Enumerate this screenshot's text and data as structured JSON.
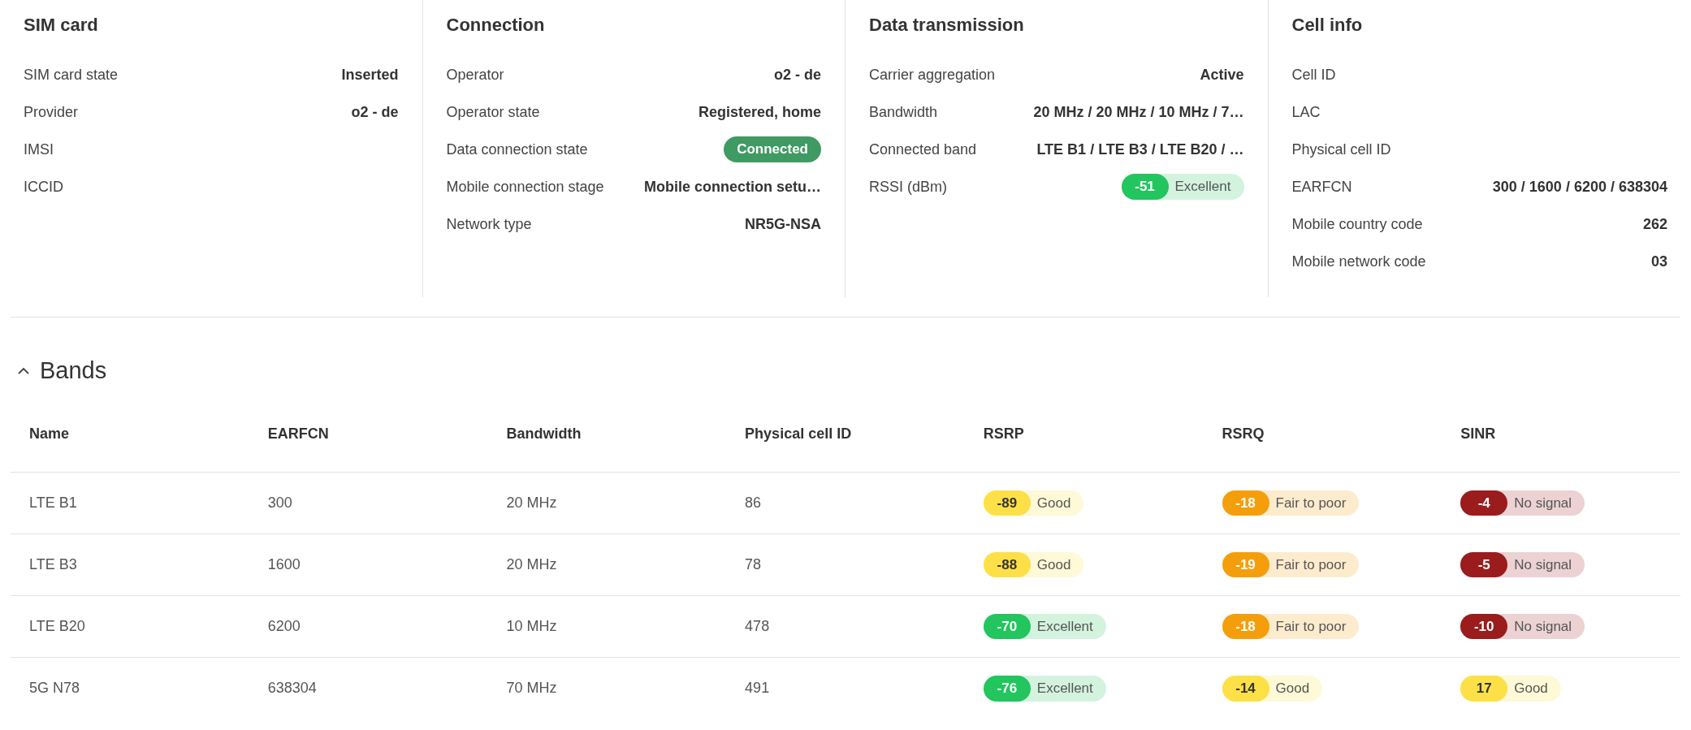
{
  "panels": [
    {
      "title": "SIM card",
      "rows": [
        {
          "kind": "text",
          "label": "SIM card state",
          "value": "Inserted"
        },
        {
          "kind": "text",
          "label": "Provider",
          "value": "o2 - de"
        },
        {
          "kind": "text",
          "label": "IMSI"
        },
        {
          "kind": "text",
          "label": "ICCID"
        }
      ]
    },
    {
      "title": "Connection",
      "rows": [
        {
          "kind": "text",
          "label": "Operator",
          "value": "o2 - de"
        },
        {
          "kind": "text",
          "label": "Operator state",
          "value": "Registered, home"
        },
        {
          "kind": "status",
          "label": "Data connection state",
          "value": "Connected"
        },
        {
          "kind": "text",
          "label": "Mobile connection stage",
          "value": "Mobile connection setu…"
        },
        {
          "kind": "text",
          "label": "Network type",
          "value": "NR5G-NSA"
        }
      ]
    },
    {
      "title": "Data transmission",
      "rows": [
        {
          "kind": "text",
          "label": "Carrier aggregation",
          "value": "Active"
        },
        {
          "kind": "text",
          "label": "Bandwidth",
          "value": "20 MHz / 20 MHz / 10 MHz / 7…"
        },
        {
          "kind": "text",
          "label": "Connected band",
          "value": "LTE B1 / LTE B3 / LTE B20 / …"
        },
        {
          "kind": "signal",
          "label": "RSSI (dBm)",
          "signal": {
            "value": "-51",
            "kind": "excellent",
            "rating": "Excellent"
          }
        }
      ]
    },
    {
      "title": "Cell info",
      "rows": [
        {
          "kind": "text",
          "label": "Cell ID"
        },
        {
          "kind": "text",
          "label": "LAC"
        },
        {
          "kind": "text",
          "label": "Physical cell ID"
        },
        {
          "kind": "text",
          "label": "EARFCN",
          "value": "300 / 1600 / 6200 / 638304"
        },
        {
          "kind": "text",
          "label": "Mobile country code",
          "value": "262"
        },
        {
          "kind": "text",
          "label": "Mobile network code",
          "value": "03"
        }
      ]
    }
  ],
  "bands": {
    "title": "Bands",
    "expanded": true,
    "columns": [
      "Name",
      "EARFCN",
      "Bandwidth",
      "Physical cell ID",
      "RSRP",
      "RSRQ",
      "SINR"
    ],
    "rows": [
      {
        "cells": [
          "LTE B1",
          "300",
          "20 MHz",
          "86"
        ],
        "signals": [
          {
            "value": "-89",
            "kind": "good",
            "rating": "Good"
          },
          {
            "value": "-18",
            "kind": "fair",
            "rating": "Fair to poor"
          },
          {
            "value": "-4",
            "kind": "none",
            "rating": "No signal"
          }
        ]
      },
      {
        "cells": [
          "LTE B3",
          "1600",
          "20 MHz",
          "78"
        ],
        "signals": [
          {
            "value": "-88",
            "kind": "good",
            "rating": "Good"
          },
          {
            "value": "-19",
            "kind": "fair",
            "rating": "Fair to poor"
          },
          {
            "value": "-5",
            "kind": "none",
            "rating": "No signal"
          }
        ]
      },
      {
        "cells": [
          "LTE B20",
          "6200",
          "10 MHz",
          "478"
        ],
        "signals": [
          {
            "value": "-70",
            "kind": "excellent",
            "rating": "Excellent"
          },
          {
            "value": "-18",
            "kind": "fair",
            "rating": "Fair to poor"
          },
          {
            "value": "-10",
            "kind": "none",
            "rating": "No signal"
          }
        ]
      },
      {
        "cells": [
          "5G N78",
          "638304",
          "70 MHz",
          "491"
        ],
        "signals": [
          {
            "value": "-76",
            "kind": "excellent",
            "rating": "Excellent"
          },
          {
            "value": "-14",
            "kind": "good",
            "rating": "Good"
          },
          {
            "value": "17",
            "kind": "good",
            "rating": "Good"
          }
        ]
      }
    ]
  }
}
